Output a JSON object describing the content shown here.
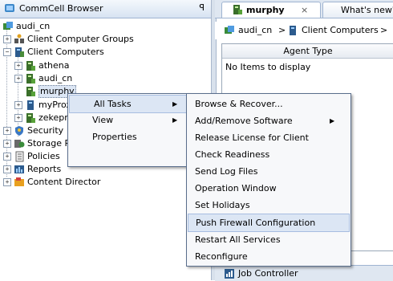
{
  "left_pane": {
    "title": "CommCell Browser",
    "pin_glyph": "ꟼ",
    "tree": {
      "root": "audi_cn",
      "client_groups": "Client Computer Groups",
      "client_computers": "Client Computers",
      "clients": [
        "athena",
        "audi_cn",
        "murphy",
        "myProx",
        "zekepro"
      ],
      "security": "Security",
      "storage": "Storage Re",
      "policies": "Policies",
      "reports": "Reports",
      "content_director": "Content Director"
    }
  },
  "tabs": [
    {
      "label": "murphy",
      "close": "×"
    },
    {
      "label": "What's new?"
    }
  ],
  "breadcrumb": {
    "root": "audi_cn",
    "sep": ">",
    "item": "Client Computers",
    "sep2": ">"
  },
  "table": {
    "column": "Agent Type",
    "empty": "No Items to display"
  },
  "job_controller": "Job Controller",
  "context_menu": {
    "items": [
      "All Tasks",
      "View",
      "Properties"
    ]
  },
  "submenu": {
    "items": [
      "Browse & Recover...",
      "Add/Remove Software",
      "Release License for Client",
      "Check Readiness",
      "Send Log Files",
      "Operation Window",
      "Set Holidays",
      "Push Firewall Configuration",
      "Restart All Services",
      "Reconfigure"
    ]
  },
  "colors": {
    "header_gradient_top": "#f4f8fc",
    "selection_highlight": "#dce6f4",
    "menu_border": "#5a6e8c"
  },
  "icons": {
    "commcell": "commcell-icon",
    "client": "client-computer-icon",
    "security": "security-icon",
    "storage": "storage-icon",
    "policies": "policies-icon",
    "reports": "reports-icon",
    "content_director": "content-director-icon"
  }
}
